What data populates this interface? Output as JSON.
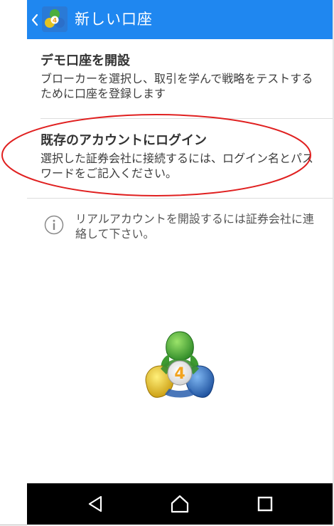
{
  "header": {
    "title": "新しい口座"
  },
  "menu": {
    "items": [
      {
        "title": "デモ口座を開設",
        "description": "ブローカーを選択し、取引を学んで戦略をテストするために口座を登録します"
      },
      {
        "title": "既存のアカウントにログイン",
        "description": "選択した証券会社に接続するには、ログイン名とパスワードをご記入ください。"
      }
    ]
  },
  "info": {
    "text": "リアルアカウントを開設するには証券会社に連絡して下さい。"
  },
  "logo": {
    "numeral": "4"
  },
  "colors": {
    "app_bar": "#1f87f0",
    "annotation": "#e02020",
    "nav_bar": "#000000"
  },
  "navigation": {
    "buttons": [
      "back",
      "home",
      "recents"
    ]
  }
}
